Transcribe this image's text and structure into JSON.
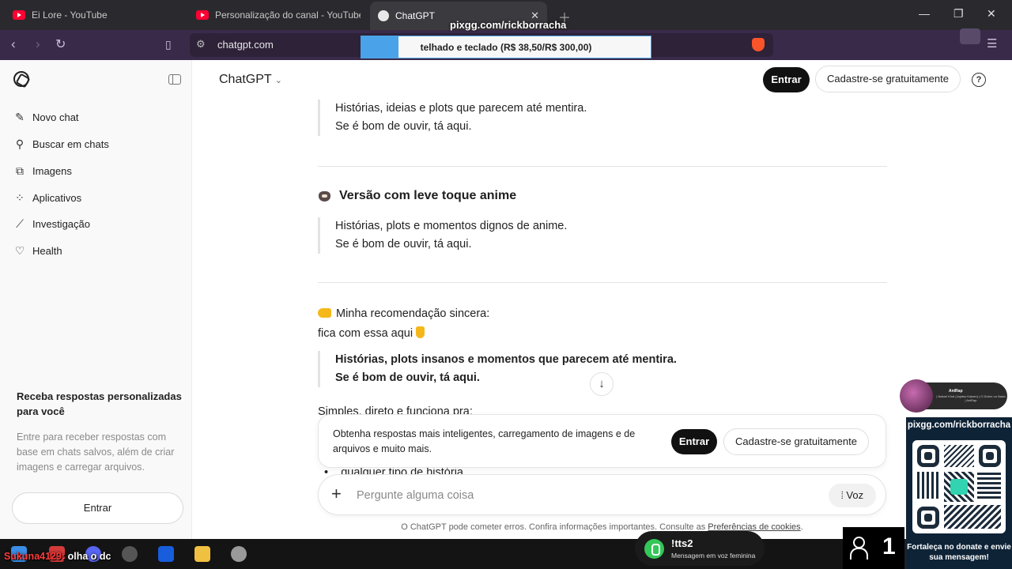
{
  "browser": {
    "tabs": [
      {
        "label": "Ei Lore - YouTube"
      },
      {
        "label": "Personalização do canal - YouTube St"
      },
      {
        "label": "ChatGPT"
      }
    ],
    "address": "chatgpt.com"
  },
  "stream": {
    "top_url": "pixgg.com/rickborracha",
    "donation_goal": "telhado e teclado (R$ 38,50/R$ 300,00)",
    "donation_fraction": 0.128,
    "profile_name": "AniRap",
    "profile_sub": "| Nakari Kind (Jujutsu Kaisen) | O Dobro ou Nada | AniRap",
    "qr_url": "pixgg.com/rickborracha",
    "qr_footer": "Fortaleça no donate e envie sua mensagem!",
    "viewer_count": "1",
    "tts_title": "!tts2",
    "tts_sub": "Mensagem em voz feminina",
    "chat_user": "Sukuna4129:",
    "chat_msg": " olha o dc"
  },
  "sidebar": {
    "items": [
      {
        "label": "Novo chat",
        "icon": "edit-icon"
      },
      {
        "label": "Buscar em chats",
        "icon": "search-icon"
      },
      {
        "label": "Imagens",
        "icon": "image-icon"
      },
      {
        "label": "Aplicativos",
        "icon": "apps-icon"
      },
      {
        "label": "Investigação",
        "icon": "telescope-icon"
      },
      {
        "label": "Health",
        "icon": "heart-icon"
      }
    ],
    "promo_title": "Receba respostas personalizadas para você",
    "promo_text": "Entre para receber respostas com base em chats salvos, além de criar imagens e carregar arquivos.",
    "login_label": "Entrar"
  },
  "header": {
    "model": "ChatGPT",
    "login_label": "Entrar",
    "signup_label": "Cadastre-se gratuitamente",
    "help": "?"
  },
  "content": {
    "quote1_line1": "Histórias, ideias e plots que parecem até mentira.",
    "quote1_line2": "Se é bom de ouvir, tá aqui.",
    "section_title": "Versão com leve toque anime",
    "quote2_line1": "Histórias, plots e momentos dignos de anime.",
    "quote2_line2": "Se é bom de ouvir, tá aqui.",
    "recommendation": "Minha recomendação sincera:",
    "pick": "fica com essa aqui",
    "quote3_line1": "Histórias, plots insanos e momentos que parecem até mentira.",
    "quote3_line2": "Se é bom de ouvir, tá aqui.",
    "partial_line": "Simples, direto e funciona pra:",
    "bullet_partial": "qualquer tipo de história"
  },
  "upsell": {
    "text": "Obtenha respostas mais inteligentes, carregamento de imagens e de arquivos e muito mais.",
    "login_label": "Entrar",
    "signup_label": "Cadastre-se gratuitamente"
  },
  "composer": {
    "placeholder": "Pergunte alguma coisa",
    "voice_label": "Voz"
  },
  "footer": {
    "disclaimer_prefix": "O ChatGPT pode cometer erros. Confira informações importantes. Consulte as ",
    "disclaimer_link": "Preferências de cookies",
    "disclaimer_suffix": "."
  }
}
